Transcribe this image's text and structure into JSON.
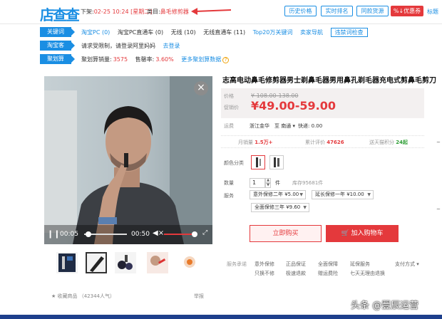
{
  "topbar": {
    "logo_text": "店查查",
    "down_prefix": "下架:",
    "down_time": "02-25 10:24 [星期二]",
    "cat_prefix": "类目:",
    "category": "鼻毛修剪器",
    "buttons": [
      "历史价格",
      "实时排名",
      "同款货源"
    ],
    "coupon_label": "%↓优惠券",
    "edge_text": "标题"
  },
  "rows": {
    "keywords": {
      "label": "关键词",
      "items": [
        "淘宝PC (0)",
        "淘宝PC直通车 (0)",
        "无线 (10)",
        "无线直通车 (11)",
        "Top20万关键词",
        "卖家导航"
      ],
      "action": "违禁词检查"
    },
    "taoke": {
      "label": "淘宝客",
      "text": "请求受限制，请登录阿里妈妈",
      "link": "去登录"
    },
    "juhuasuan": {
      "label": "聚划算",
      "sales_label": "聚划算销量:",
      "sales_value": "3575",
      "rate_label": "售罄率:",
      "rate_value": "3.60%",
      "more_link": "更多聚划算数据",
      "help_icon": "?"
    }
  },
  "gallery": {
    "close_icon": "×",
    "play_icon": "❙❙",
    "time_current": "00:05",
    "time_duration": "00:50",
    "progress_fraction": 0.1,
    "volume_icon": "◀×",
    "volume_fraction": 0.9,
    "fullscreen_icon": "⤢",
    "fav_text": "★ 收藏商品 （42344人气）",
    "report_text": "举报"
  },
  "product": {
    "title": "志高电动鼻毛修剪器男士剃鼻毛器男用鼻孔剃毛器充电式剪鼻毛剪刀",
    "price_label": "价格",
    "original_price": "¥ 108.00-138.00",
    "promo_label": "促销价",
    "promo_price": "¥49.00-59.00",
    "ship_label": "运费",
    "ship_from": "浙江金华",
    "ship_to": "至 南通 ▾",
    "ship_fee": "快递: 0.00",
    "monthly_sales_label": "月销量",
    "monthly_sales_value": "1.5万+",
    "reviews_label": "累计评价",
    "reviews_value": "47626",
    "points_label": "送天猫积分",
    "points_value": "24起",
    "color_label": "颜色分类",
    "qty_label": "数量",
    "qty_value": "1",
    "qty_unit": "件",
    "stock_text": "库存95681件",
    "service_label": "服务",
    "services": [
      "意外保修二年 ¥5.00",
      "延长保修一年 ¥10.00",
      "全面保修三年 ¥9.60"
    ],
    "buy_label": "立即购买",
    "cart_label": "加入购物车",
    "promise_label": "服务承诺",
    "promises_row1": [
      "意外保修",
      "正品保证",
      "全面保障",
      "延保服务"
    ],
    "promises_row2": [
      "只换不修",
      "极速退款",
      "赠运费险",
      "七天无理由退换"
    ],
    "payment_label": "支付方式 ▾"
  },
  "watermark": "头条 @豐辰运营"
}
